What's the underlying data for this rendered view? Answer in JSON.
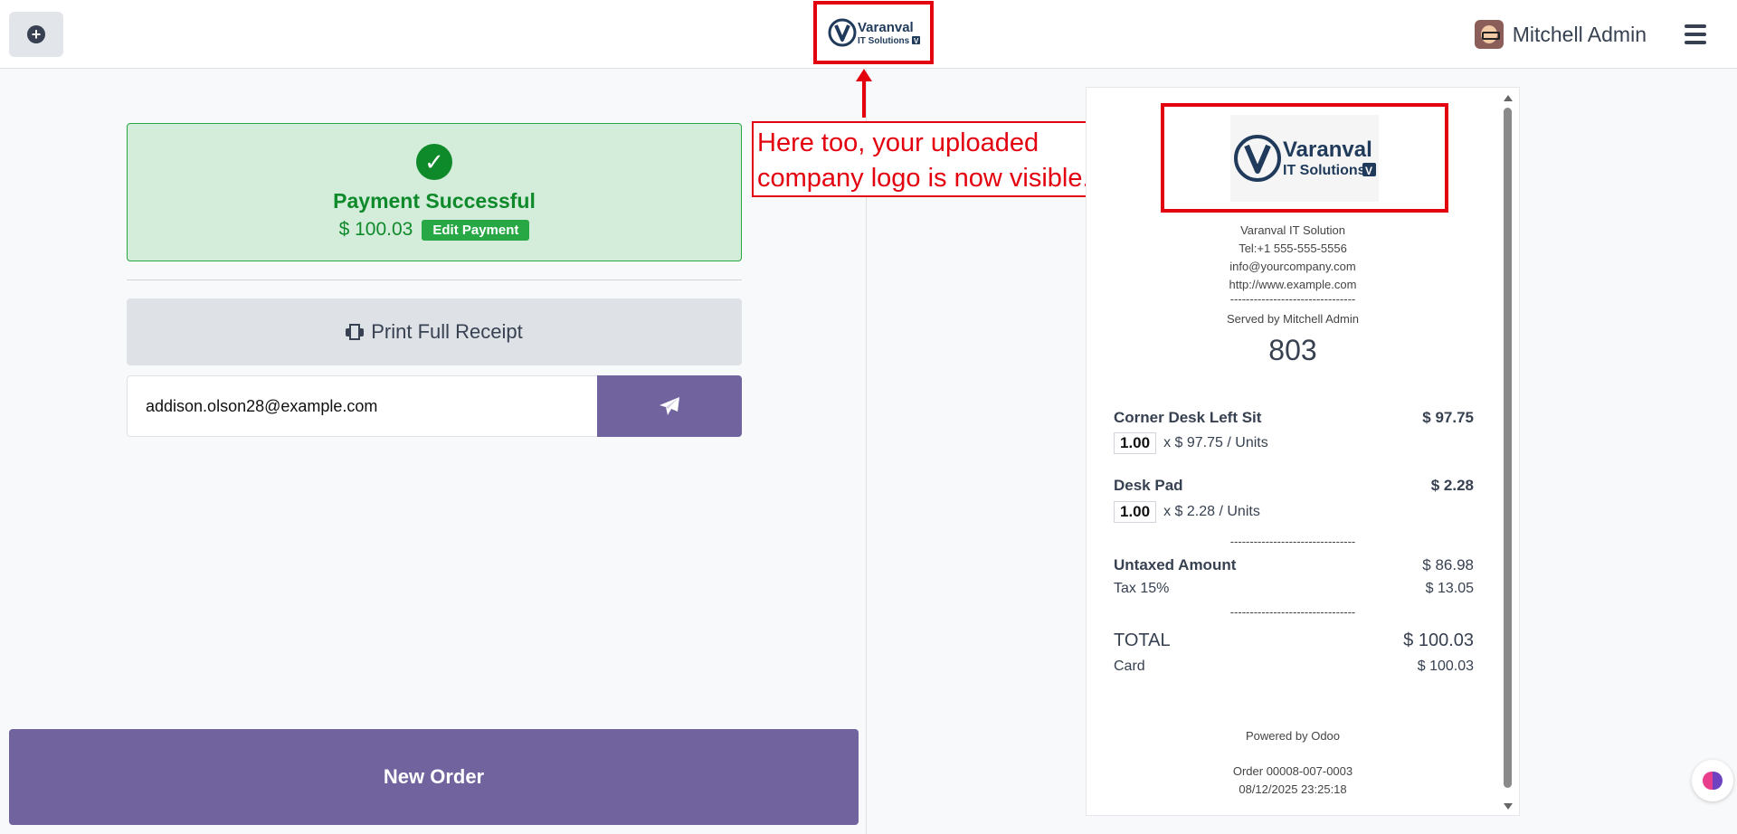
{
  "header": {
    "logo_text_main": "Varanval",
    "logo_text_sub": "IT Solutions",
    "logo_initial": "V",
    "user_name": "Mitchell Admin"
  },
  "payment": {
    "status": "Payment Successful",
    "amount": "$ 100.03",
    "edit_label": "Edit Payment"
  },
  "actions": {
    "print_label": "Print Full Receipt",
    "email_value": "addison.olson28@example.com",
    "new_order_label": "New Order"
  },
  "annotation": {
    "line1": "Here too, your uploaded",
    "line2": "company logo is now visible."
  },
  "receipt": {
    "company_name": "Varanval IT Solution",
    "tel": "Tel:+1 555-555-5556",
    "email": "info@yourcompany.com",
    "website": "http://www.example.com",
    "separator_short": "--------------------------------",
    "served_by": "Served by Mitchell Admin",
    "order_number": "803",
    "lines": [
      {
        "name": "Corner Desk Left Sit",
        "total": "$ 97.75",
        "qty": "1.00",
        "unit_price": "x $ 97.75 / Units"
      },
      {
        "name": "Desk Pad",
        "total": "$ 2.28",
        "qty": "1.00",
        "unit_price": "x $ 2.28 / Units"
      }
    ],
    "separator": "--------------------------------",
    "untaxed_label": "Untaxed Amount",
    "untaxed_value": "$ 86.98",
    "tax_label": "Tax 15%",
    "tax_value": "$ 13.05",
    "total_label": "TOTAL",
    "total_value": "$ 100.03",
    "payment_method": "Card",
    "payment_value": "$ 100.03",
    "powered_by": "Powered by Odoo",
    "order_ref": "Order 00008-007-0003",
    "datetime": "08/12/2025 23:25:18"
  }
}
